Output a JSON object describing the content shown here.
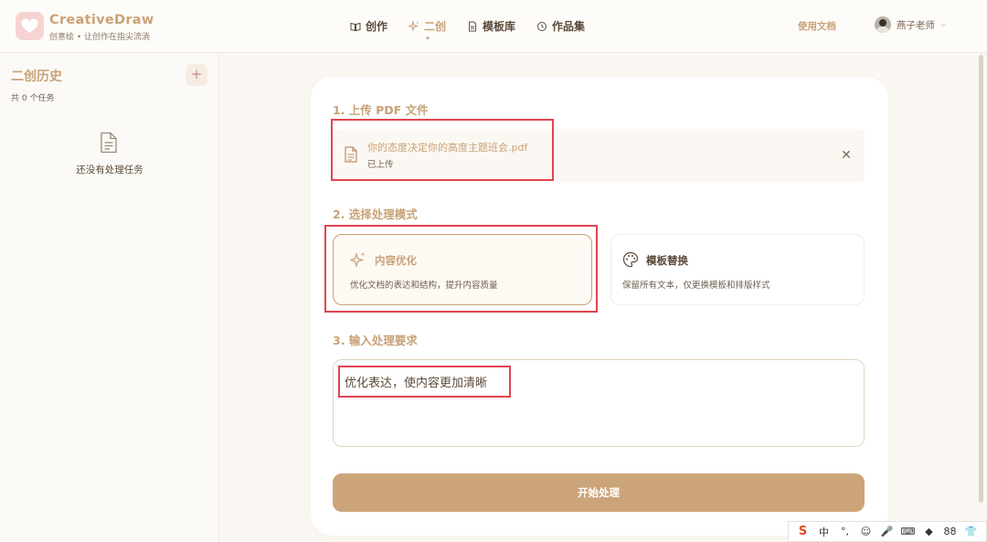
{
  "header": {
    "brand": "CreativeDraw",
    "tagline": "创意绘 • 让创作在指尖流淌",
    "nav": [
      {
        "label": "创作",
        "icon": "book-open-icon",
        "active": false
      },
      {
        "label": "二创",
        "icon": "sparkle-icon",
        "active": true
      },
      {
        "label": "模板库",
        "icon": "document-icon",
        "active": false
      },
      {
        "label": "作品集",
        "icon": "history-icon",
        "active": false
      }
    ],
    "docs_link": "使用文档",
    "user_name": "燕子老师"
  },
  "sidebar": {
    "title": "二创历史",
    "add_symbol": "+",
    "task_count": "共 0 个任务",
    "empty_text": "还没有处理任务"
  },
  "main": {
    "step1_title": "1. 上传 PDF 文件",
    "file_name": "你的态度决定你的高度主题班会.pdf",
    "file_status": "已上传",
    "close_symbol": "✕",
    "step2_title": "2. 选择处理模式",
    "modes": [
      {
        "title": "内容优化",
        "desc": "优化文档的表达和结构，提升内容质量",
        "selected": true
      },
      {
        "title": "模板替换",
        "desc": "保留所有文本，仅更换模板和排版样式",
        "selected": false
      }
    ],
    "step3_title": "3. 输入处理要求",
    "requirement_value": "优化表达，使内容更加清晰",
    "start_button": "开始处理"
  },
  "ime": {
    "items": [
      "S",
      "中",
      "°,",
      "☺",
      "🎤",
      "⌨",
      "◆",
      "88",
      "👕"
    ]
  },
  "colors": {
    "accent": "#c8a277",
    "button": "#cca47a",
    "highlight": "#e0454f",
    "background": "#fbf8f3"
  }
}
